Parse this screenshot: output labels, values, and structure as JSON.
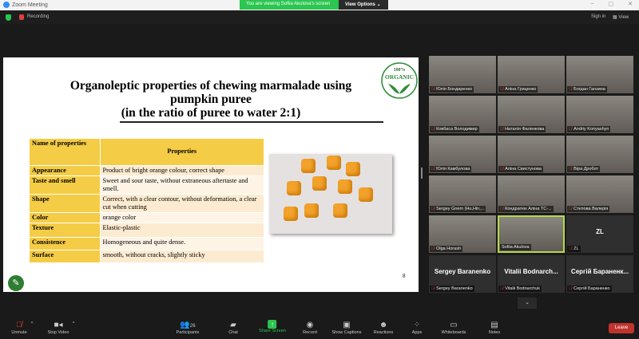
{
  "window": {
    "title": "Zoom Meeting",
    "banner": "You are viewing Sofiia Akulova's screen",
    "view_options": "View Options",
    "controls": [
      "–",
      "▢",
      "✕"
    ]
  },
  "topbar": {
    "recording": "Recording",
    "sign_in": "Sign in",
    "view": "View"
  },
  "slide": {
    "title_line1": "Organoleptic properties of chewing marmalade using",
    "title_line2": "pumpkin puree",
    "title_line3": "(in the ratio of puree to water 2:1)",
    "logo_text": "ORGANIC",
    "logo_top": "100%",
    "page": "8",
    "table": {
      "headers": [
        "Name of properties",
        "Properties"
      ],
      "rows": [
        [
          "Appearance",
          "Product of bright orange colour, correct shape"
        ],
        [
          "Taste and smell",
          "Sweet and sour taste, without extraneous aftertaste and smell."
        ],
        [
          "Shape",
          "Correct, with a clear contour, without deformation, a clear cut when cutting"
        ],
        [
          "Color",
          "orange color"
        ],
        [
          "Texture",
          "Elastic-plastic"
        ],
        [
          "Consistence",
          "Homogeneous and quite dense."
        ],
        [
          "Surface",
          "smooth, without cracks, slightly sticky"
        ]
      ]
    }
  },
  "participants": [
    {
      "name": "Юлія Бондаренко"
    },
    {
      "name": "Аліна Гриценко"
    },
    {
      "name": "Богдан Ганзина"
    },
    {
      "name": "Ковбаса Володимир"
    },
    {
      "name": "Наталія Фаленкова"
    },
    {
      "name": "Andriy Konyashyn"
    },
    {
      "name": "Юлія Камбулова"
    },
    {
      "name": "Аліна Свистунова"
    },
    {
      "name": "Віра Дробот"
    },
    {
      "name": "Sergey Gnem (Hu,Hin,..."
    },
    {
      "name": "Кондратюк Аліна ТС-..."
    },
    {
      "name": "Степова Валерія"
    },
    {
      "name": "Olga Horash"
    },
    {
      "name": "Sofiia Akulova"
    },
    {
      "name": "ZL",
      "initials": "ZL"
    },
    {
      "name": "Sergey Baranenko",
      "display": "Sergey Baranenko"
    },
    {
      "name": "Vitalii Bodnarchuk",
      "display": "Vitalii  Bodnarch..."
    },
    {
      "name": "Сергій Бараненко",
      "display": "Сергій  Бараненк..."
    }
  ],
  "toolbar": {
    "unmute": "Unmute",
    "stop_video": "Stop Video",
    "participants": "Participants",
    "participants_count": "26",
    "chat": "Chat",
    "share": "Share Screen",
    "record": "Record",
    "captions": "Show Captions",
    "reactions": "Reactions",
    "apps": "Apps",
    "whiteboards": "Whiteboards",
    "notes": "Notes",
    "leave": "Leave"
  }
}
